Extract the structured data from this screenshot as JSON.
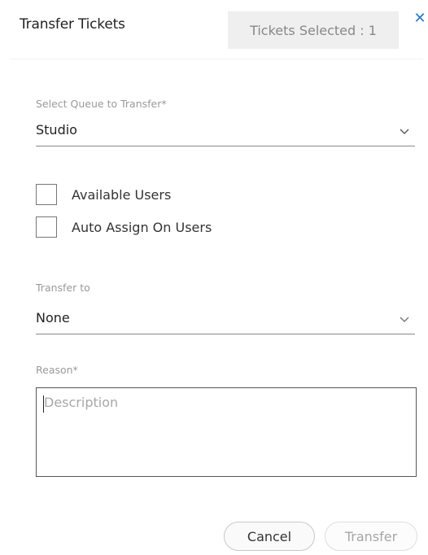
{
  "dialog": {
    "title": "Transfer Tickets",
    "tickets_selected": "Tickets Selected : 1",
    "close_glyph": "✕"
  },
  "queue": {
    "label": "Select Queue to Transfer*",
    "value": "Studio"
  },
  "options": {
    "available_users": {
      "label": "Available Users",
      "checked": false
    },
    "auto_assign": {
      "label": "Auto Assign On Users",
      "checked": false
    }
  },
  "transfer_to": {
    "label": "Transfer to",
    "value": "None"
  },
  "reason": {
    "label": "Reason*",
    "placeholder": "Description"
  },
  "buttons": {
    "cancel": "Cancel",
    "transfer": "Transfer"
  },
  "colors": {
    "accent": "#2a78c2",
    "badge_bg": "#efefef",
    "muted_text": "#9a9a9a"
  }
}
